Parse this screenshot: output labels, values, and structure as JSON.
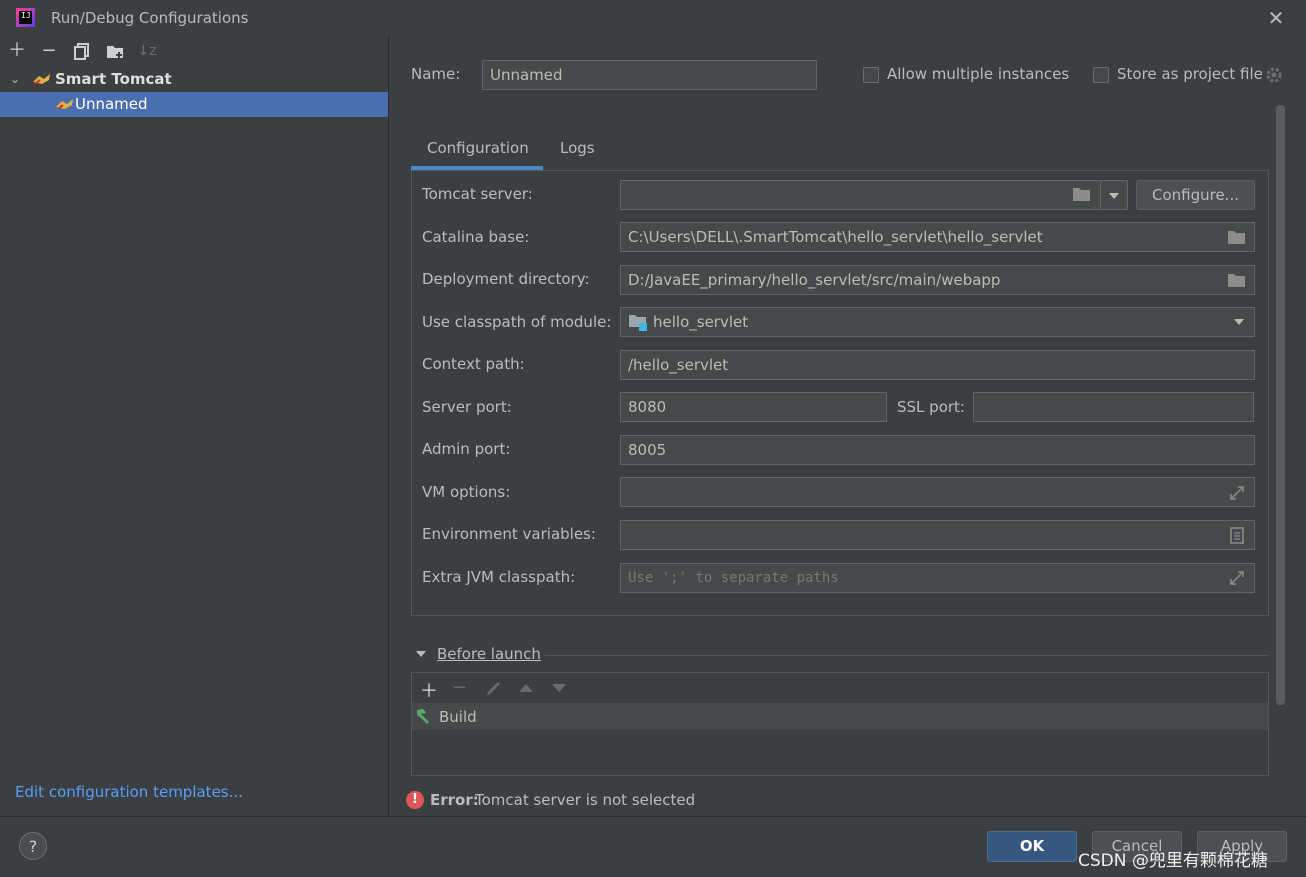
{
  "window": {
    "title": "Run/Debug Configurations"
  },
  "toolbar": {
    "icons": [
      "plus-icon",
      "minus-icon",
      "copy-icon",
      "folder-add-icon",
      "sort-icon"
    ]
  },
  "tree": {
    "group_label": "Smart Tomcat",
    "item_label": "Unnamed"
  },
  "left_link": "Edit configuration templates...",
  "name_label": "Name:",
  "name_value": "Unnamed",
  "allow_multiple": "Allow multiple instances",
  "store_as_project": "Store as project file",
  "tabs": [
    {
      "label": "Configuration"
    },
    {
      "label": "Logs"
    }
  ],
  "form": {
    "tomcat_server": {
      "label": "Tomcat server:",
      "value": ""
    },
    "configure_btn": "Configure...",
    "catalina_base": {
      "label": "Catalina base:",
      "value": "C:\\Users\\DELL\\.SmartTomcat\\hello_servlet\\hello_servlet"
    },
    "deployment_dir": {
      "label": "Deployment directory:",
      "value": "D:/JavaEE_primary/hello_servlet/src/main/webapp"
    },
    "classpath_module": {
      "label": "Use classpath of module:",
      "value": "hello_servlet"
    },
    "context_path": {
      "label": "Context path:",
      "value": "/hello_servlet"
    },
    "server_port": {
      "label": "Server port:",
      "value": "8080"
    },
    "ssl_port": {
      "label": "SSL port:",
      "value": ""
    },
    "admin_port": {
      "label": "Admin port:",
      "value": "8005"
    },
    "vm_options": {
      "label": "VM options:",
      "value": ""
    },
    "env_vars": {
      "label": "Environment variables:",
      "value": ""
    },
    "extra_jvm": {
      "label": "Extra JVM classpath:",
      "placeholder": "Use ';' to separate paths"
    }
  },
  "before_launch": {
    "label": "Before launch",
    "items": [
      {
        "label": "Build"
      }
    ]
  },
  "error": {
    "prefix": "Error:",
    "message": "Tomcat server is not selected"
  },
  "buttons": {
    "ok": "OK",
    "cancel": "Cancel",
    "apply": "Apply"
  },
  "watermark": "CSDN @兜里有颗棉花糖",
  "colors": {
    "accent": "#4a88c7",
    "selection": "#4b6eaf",
    "link": "#589df6",
    "error": "#e05555"
  }
}
